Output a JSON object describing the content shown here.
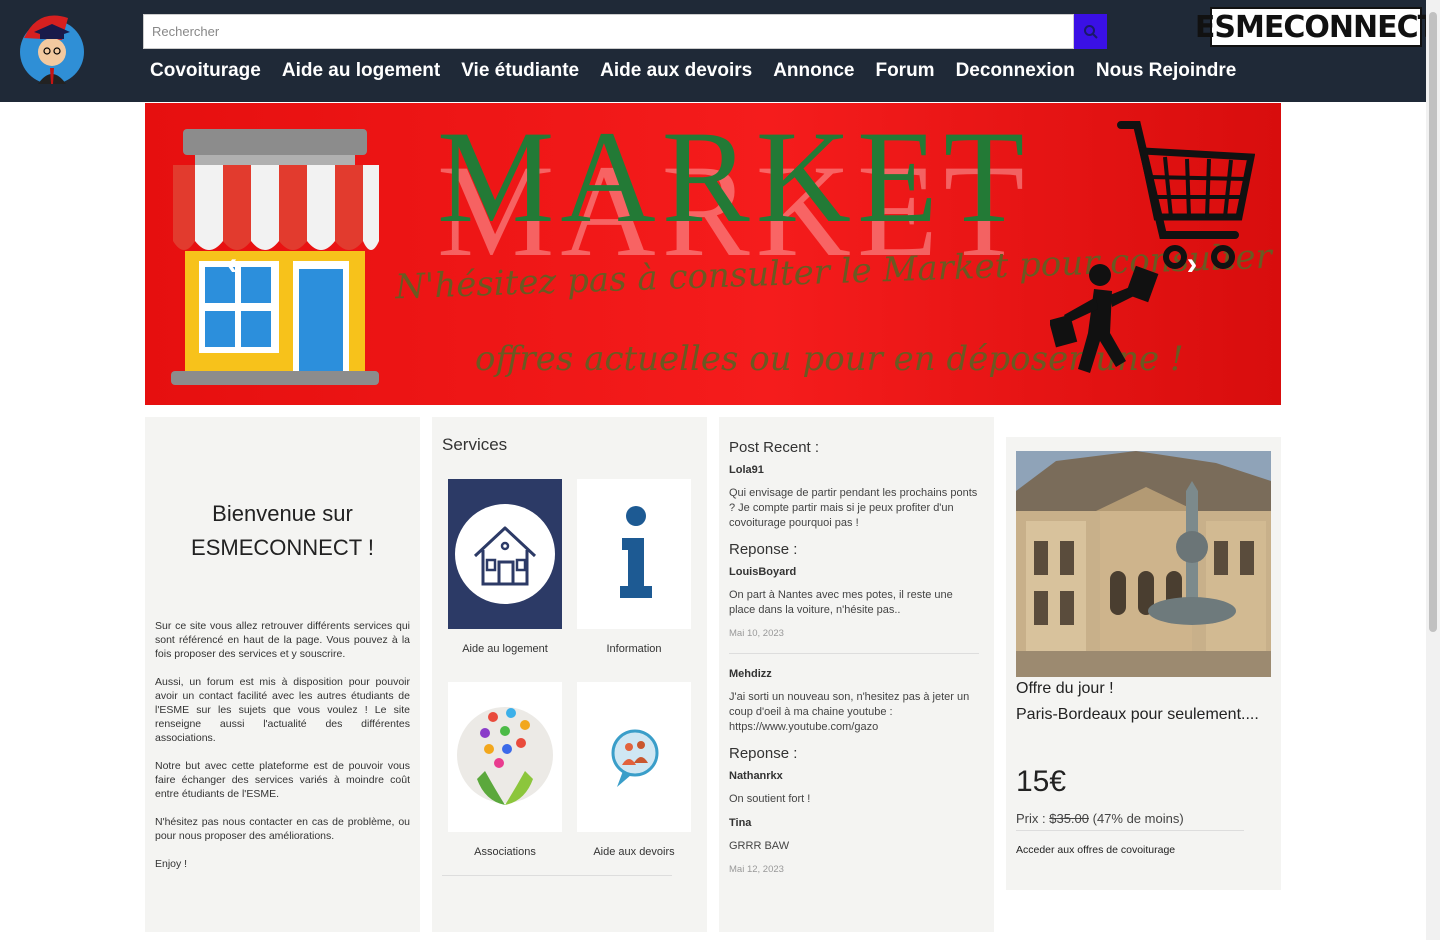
{
  "header": {
    "logo_icon": "graduate-avatar-logo",
    "search_placeholder": "Rechercher",
    "search_icon": "search-icon",
    "brand": "ESMECONNECT",
    "nav": [
      "Covoiturage",
      "Aide au logement",
      "Vie étudiante",
      "Aide aux devoirs",
      "Annonce",
      "Forum",
      "Deconnexion",
      "Nous Rejoindre"
    ]
  },
  "banner": {
    "title": "MARKET",
    "line1": "N'hésitez pas à consulter le Market pour consulter les",
    "line2": "offres actuelles ou pour en déposer une !",
    "prev": "‹",
    "next": "›",
    "colors": {
      "background": "#e60f0f",
      "title": "#237a36",
      "script": "#6a5a22"
    }
  },
  "welcome": {
    "title_line1": "Bienvenue sur",
    "title_line2": "ESMECONNECT !",
    "paragraphs": [
      "Sur ce site vous allez retrouver différents services qui sont référencé en haut de la page. Vous pouvez à la fois proposer des services et y souscrire.",
      "Aussi, un forum est mis à disposition pour pouvoir avoir un contact facilité avec les autres étudiants de l'ESME sur les sujets que vous voulez ! Le site renseigne aussi l'actualité des différentes associations.",
      "Notre but avec cette plateforme est de pouvoir vous faire échanger des services variés à moindre coût entre étudiants de l'ESME.",
      "N'hésitez pas nous contacter en cas de problème, ou pour nous proposer des améliorations.",
      "Enjoy !"
    ]
  },
  "services": {
    "title": "Services",
    "items": [
      {
        "label": "Aide au logement",
        "icon": "house-icon"
      },
      {
        "label": "Information",
        "icon": "info-icon"
      },
      {
        "label": "Associations",
        "icon": "associations-icon"
      },
      {
        "label": "Aide aux devoirs",
        "icon": "chat-people-icon"
      }
    ]
  },
  "posts": {
    "title": "Post Recent :",
    "post1": {
      "user": "Lola91",
      "text": "Qui envisage de partir pendant les prochains ponts ? Je compte partir mais si je peux profiter d'un covoiturage pourquoi pas !",
      "reply_label": "Reponse :",
      "reply_user": "LouisBoyard",
      "reply_text": "On part à Nantes avec mes potes, il reste une place dans la voiture, n'hésite pas..",
      "date": "Mai 10, 2023"
    },
    "post2": {
      "user": "Mehdizz",
      "text": "J'ai sorti un nouveau son, n'hesitez pas à jeter un coup d'oeil à ma chaine youtube : https://www.youtube.com/gazo",
      "reply_label": "Reponse :",
      "reply1_user": "Nathanrkx",
      "reply1_text": "On soutient fort !",
      "reply2_user": "Tina",
      "reply2_text": "GRRR BAW",
      "date": "Mai 12, 2023"
    }
  },
  "offer": {
    "title": "Offre du jour !",
    "route": "Paris-Bordeaux pour seulement....",
    "price": "15€",
    "old_prefix": "Prix : ",
    "old_price": "$35.00",
    "discount": " (47% de moins)",
    "link": "Acceder aux offres de covoiturage"
  }
}
